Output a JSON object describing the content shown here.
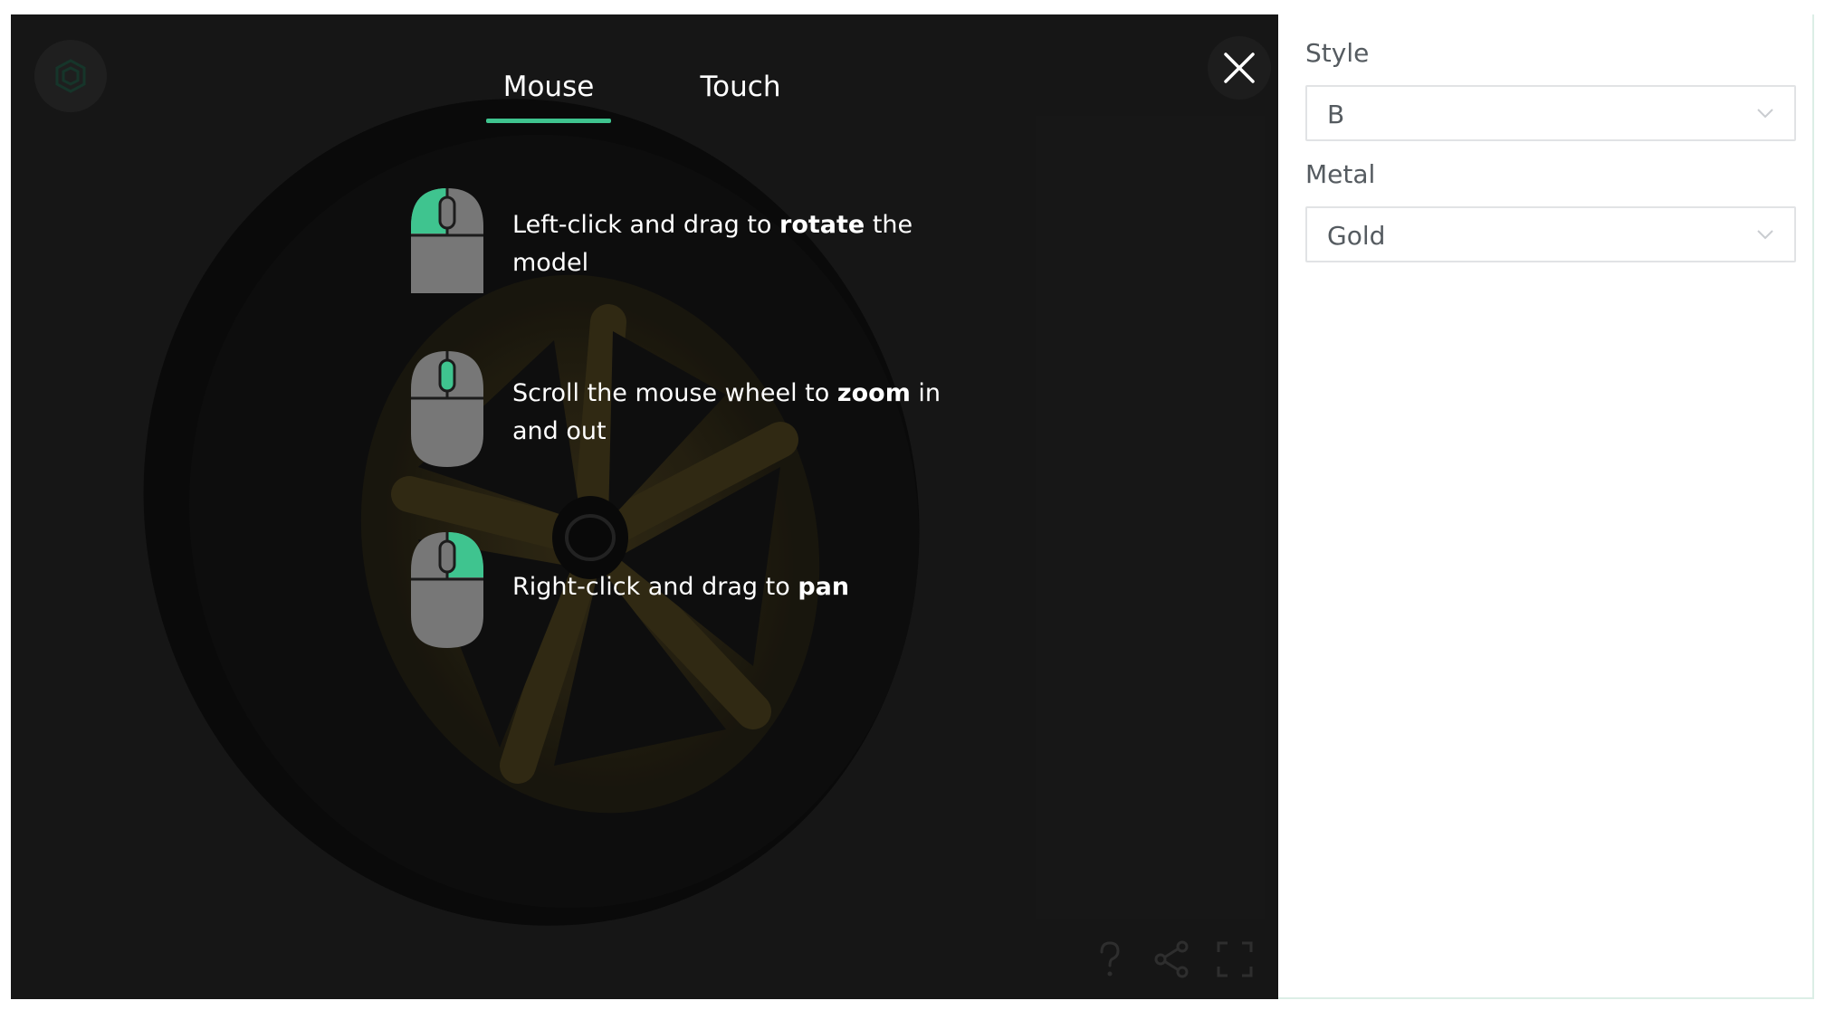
{
  "tabs": {
    "mouse": "Mouse",
    "touch": "Touch"
  },
  "hints": {
    "rotate": {
      "before": "Left-click and drag to ",
      "bold": "rotate",
      "after": " the model"
    },
    "zoom": {
      "before": "Scroll the mouse wheel to ",
      "bold": "zoom",
      "after": " in and out"
    },
    "pan": {
      "before": "Right-click and drag to ",
      "bold": "pan",
      "after": ""
    }
  },
  "panel": {
    "style_label": "Style",
    "style_value": "B",
    "metal_label": "Metal",
    "metal_value": "Gold"
  },
  "colors": {
    "accent": "#3fc48f",
    "viewer_bg": "#1c1c1c",
    "mouse_grey": "#777777"
  },
  "icons": [
    "close-icon",
    "logo-icon",
    "help-icon",
    "share-icon",
    "fullscreen-icon",
    "chevron-down-icon",
    "mouse-icon"
  ]
}
